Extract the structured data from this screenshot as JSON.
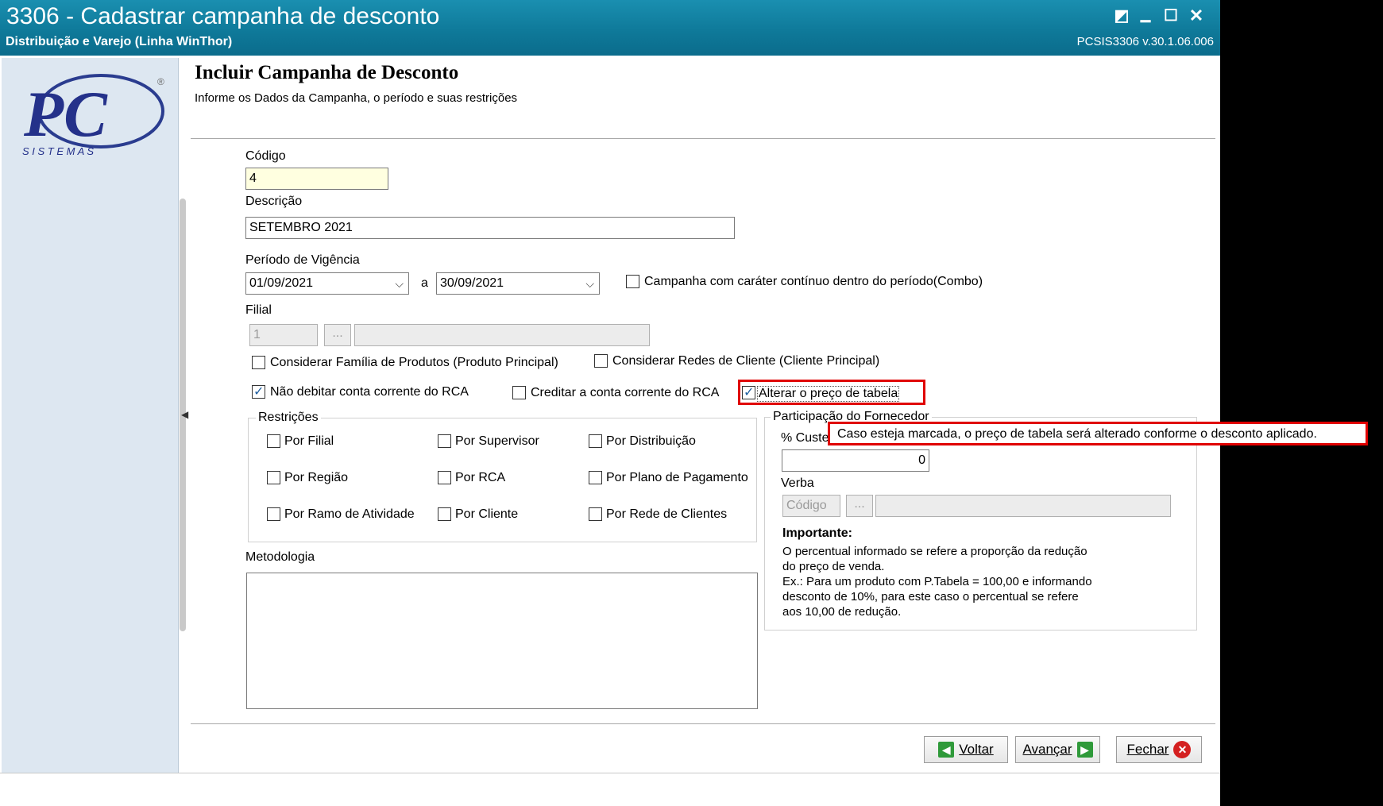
{
  "window": {
    "title": "3306 - Cadastrar campanha de desconto",
    "subtitle": "Distribuição e Varejo (Linha WinThor)",
    "version": "PCSIS3306  v.30.1.06.006",
    "controls": {
      "restore": "◩",
      "minimize": "▁",
      "maximize": "☐",
      "close": "✕"
    }
  },
  "logo": {
    "letters": "PC",
    "brand": "S I S T E M A S",
    "registered": "®"
  },
  "header": {
    "title": "Incluir Campanha de Desconto",
    "description": "Informe os Dados da Campanha, o período e suas restrições"
  },
  "form": {
    "codigo_label": "Código",
    "codigo_value": "4",
    "descricao_label": "Descrição",
    "descricao_value": "SETEMBRO 2021",
    "periodo_label": "Período de Vigência",
    "data_inicio": "01/09/2021",
    "separador": "a",
    "data_fim": "30/09/2021",
    "combo_label": "Campanha com caráter contínuo dentro do período(Combo)",
    "filial_label": "Filial",
    "filial_value": "1",
    "ellipsis": "...",
    "familia_label": "Considerar Família de Produtos (Produto Principal)",
    "redes_label": "Considerar Redes de Cliente (Cliente Principal)",
    "nao_debitar_label": "Não debitar conta corrente do RCA",
    "creditar_label": "Creditar a conta corrente do RCA",
    "alterar_preco_label": "Alterar o preço de tabela"
  },
  "restricoes": {
    "title": "Restrições",
    "items": [
      "Por Filial",
      "Por Supervisor",
      "Por Distribuição",
      "Por Região",
      "Por RCA",
      "Por Plano de Pagamento",
      "Por Ramo de Atividade",
      "Por Cliente",
      "Por Rede de Clientes"
    ]
  },
  "fornecedor": {
    "title": "Participação do Fornecedor",
    "custo_label": "% Custe",
    "custo_value": "0",
    "verba_label": "Verba",
    "verba_placeholder": "Código",
    "importante_title": "Importante:",
    "importante_lines": [
      "O percentual informado se refere a proporção da redução",
      "do preço de venda.",
      "Ex.: Para um produto com P.Tabela = 100,00 e informando",
      "desconto de 10%, para este caso o percentual se refere",
      "aos 10,00 de redução."
    ]
  },
  "tooltip": "Caso esteja marcada, o preço de tabela será alterado conforme o desconto aplicado.",
  "metodologia_label": "Metodologia",
  "buttons": {
    "voltar": "Voltar",
    "avancar": "Avançar",
    "fechar": "Fechar"
  },
  "colors": {
    "titlebar": "#0e7898",
    "highlight": "#e00000",
    "field_yellow": "#ffffe0"
  }
}
